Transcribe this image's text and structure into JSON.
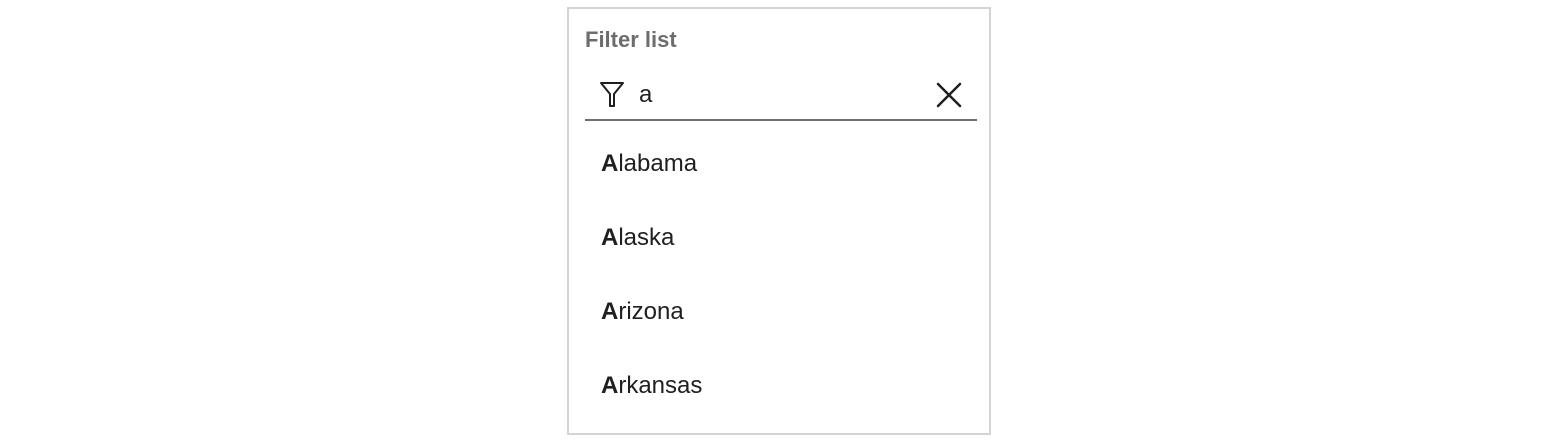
{
  "filter": {
    "label": "Filter list",
    "input_value": "a",
    "filter_icon": "filter-funnel-icon",
    "clear_icon": "close-x-icon"
  },
  "results": [
    {
      "match": "A",
      "rest": "labama"
    },
    {
      "match": "A",
      "rest": "laska"
    },
    {
      "match": "A",
      "rest": "rizona"
    },
    {
      "match": "A",
      "rest": "rkansas"
    }
  ],
  "colors": {
    "border": "#d4d4d6",
    "underline": "#6f6f72",
    "label": "#6d6d70",
    "text": "#202023"
  }
}
